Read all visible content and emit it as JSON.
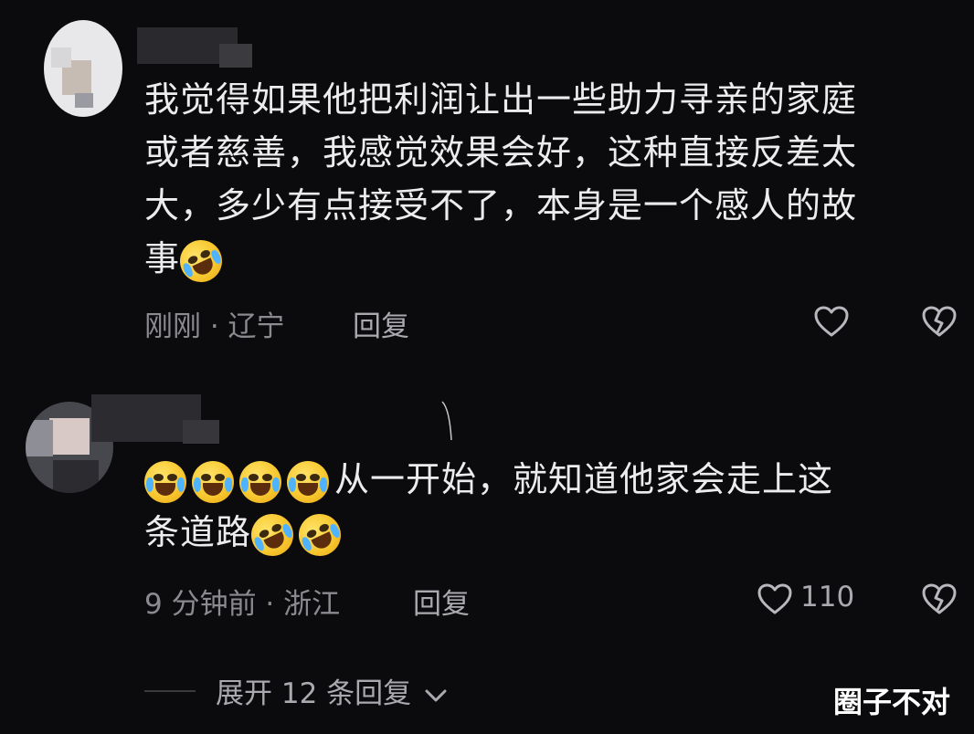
{
  "comments": [
    {
      "text_lines": [
        "我觉得如果他把利润让出一些助力寻亲的家庭",
        "或者慈善，我感觉效果会好，这种直接反差太",
        "大，多少有点接受不了，本身是一个感人的故",
        "事"
      ],
      "trailing_emoji": "rolling-laughing-emoji",
      "time_location": "刚刚 · 辽宁",
      "reply_label": "回复",
      "like_count": ""
    },
    {
      "leading_emojis": [
        "crying-laughing-emoji",
        "crying-laughing-emoji",
        "crying-laughing-emoji",
        "crying-laughing-emoji"
      ],
      "text_line1": "从一开始，就知道他家会走上这",
      "text_line2": "条道路",
      "trailing_emojis": [
        "rolling-laughing-emoji",
        "rolling-laughing-emoji"
      ],
      "time_location": "9 分钟前 · 浙江",
      "reply_label": "回复",
      "like_count": "110"
    }
  ],
  "expand_replies": "展开 12 条回复",
  "watermark": "圈子不对",
  "colors": {
    "background": "#0b0b0d",
    "text": "#ececef",
    "muted": "#8a8a90",
    "emoji": "#f8c830"
  },
  "icons": [
    "heart-icon",
    "broken-heart-icon",
    "chevron-down-icon"
  ]
}
